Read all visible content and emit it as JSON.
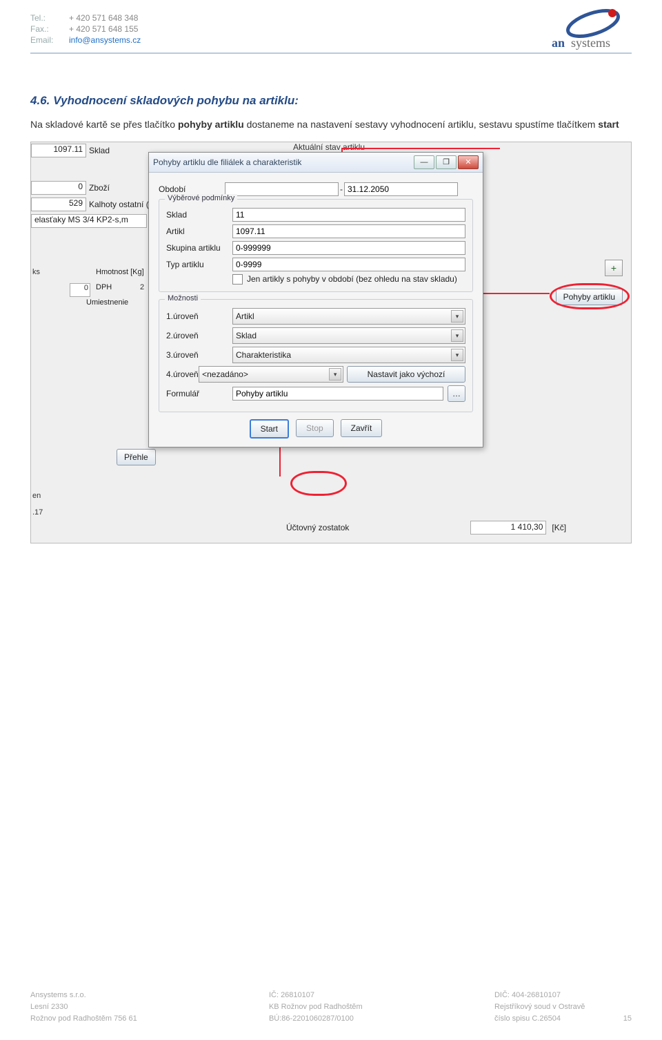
{
  "header": {
    "tel_label": "Tel.:",
    "tel": "+ 420 571 648 348",
    "fax_label": "Fax.:",
    "fax": "+ 420 571 648 155",
    "email_label": "Email:",
    "email": "info@ansystems.cz",
    "brand": "ansystems"
  },
  "section": {
    "title": "4.6. Vyhodnocení skladových pohybu na artiklu:",
    "para_pre": "Na skladové kartě se přes tlačítko ",
    "para_b1": "pohyby artiklu",
    "para_mid": " dostaneme na nastavení sestavy vyhodnocení artiklu, sestavu spustíme tlačítkem ",
    "para_b2": "start"
  },
  "shot": {
    "aktualni": "Aktuální stav artiklu",
    "left": {
      "v1": "1097.11",
      "l1": "Sklad",
      "v2": "0",
      "l2": "Zboží",
      "v3": "529",
      "l3": "Kalhoty ostatní (g",
      "v4": "elasťaky MS 3/4 KP2-s,m",
      "ks": "ks",
      "hmot": "Hmotnost [Kg]",
      "dph": "DPH",
      "dphv": "2",
      "umi": "Umiestnenie",
      "zero": "0",
      "prehle": "Přehle",
      "en": "en",
      "v17": ".17"
    },
    "dlg": {
      "title": "Pohyby artiklu dle filiálek a charakteristik",
      "min": "—",
      "max": "□",
      "close": "✕",
      "obdob": "Období",
      "obdob_to": "31.12.2050",
      "sep": "-",
      "grp1": "Výběrové podmínky",
      "sklad": "Sklad",
      "sklad_v": "11",
      "artikl": "Artikl",
      "artikl_v": "1097.11",
      "skup": "Skupina artiklu",
      "skup_v": "0-999999",
      "typ": "Typ artiklu",
      "typ_v": "0-9999",
      "chk": "Jen artikly s pohyby v období (bez ohledu na stav skladu)",
      "grp2": "Možnosti",
      "u1": "1.úroveň",
      "u1v": "Artikl",
      "u2": "2.úroveň",
      "u2v": "Sklad",
      "u3": "3.úroveň",
      "u3v": "Charakteristika",
      "u4": "4.úroveň",
      "u4v": "<nezadáno>",
      "default_btn": "Nastavit jako výchozí",
      "form": "Formulář",
      "formv": "Pohyby artiklu",
      "start": "Start",
      "stop": "Stop",
      "zavrit": "Zavřít"
    },
    "rbtn": "Pohyby artiklu",
    "bottom": {
      "lab": "Účtovný zostatok",
      "val": "1 410,30",
      "unit": "[Kč]"
    }
  },
  "footer": {
    "c1a": "Ansystems s.r.o.",
    "c1b": "Lesní 2330",
    "c1c": "Rožnov pod Radhoštěm 756 61",
    "c2a": "IČ: 26810107",
    "c2b": "KB Rožnov pod Radhoštěm",
    "c2c": "BÚ:86-2201060287/0100",
    "c3a": "DIČ: 404-26810107",
    "c3b": "Rejstříkový soud v Ostravě",
    "c3c": "číslo spisu C.26504",
    "page": "15"
  }
}
